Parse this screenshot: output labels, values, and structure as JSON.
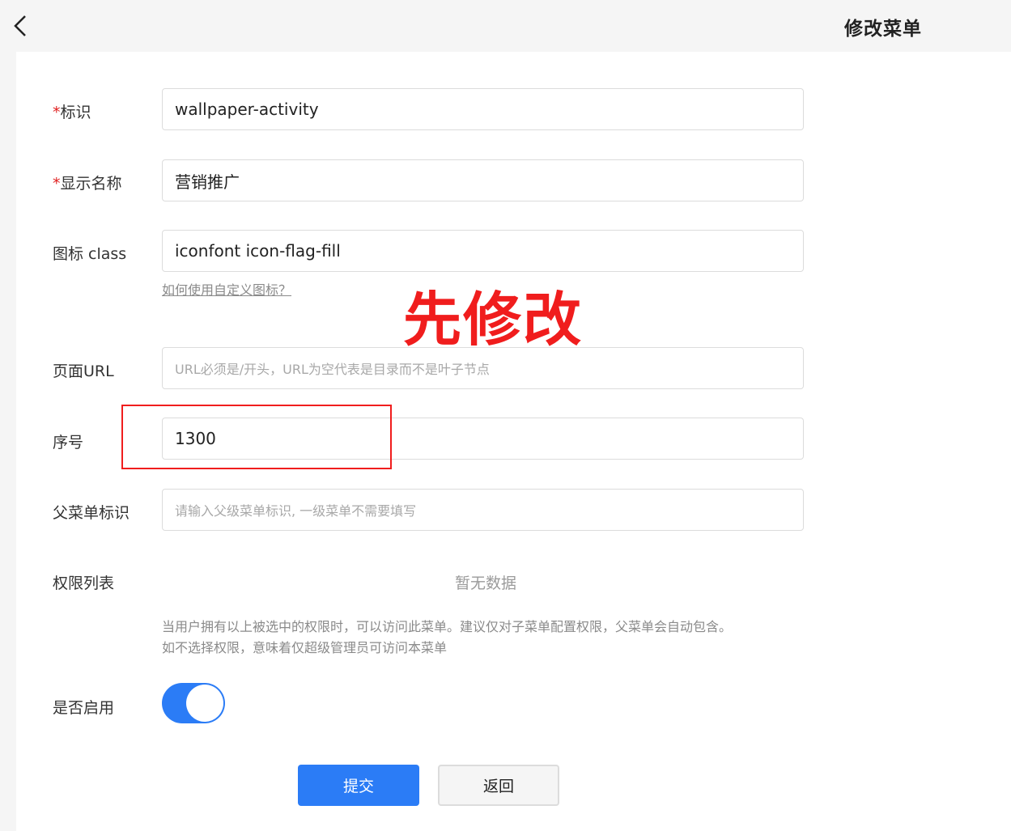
{
  "header": {
    "title": "修改菜单",
    "back_icon": "chevron-left-icon"
  },
  "form": {
    "id_field": {
      "required_mark": "*",
      "label": "标识",
      "value": "wallpaper-activity"
    },
    "name_field": {
      "required_mark": "*",
      "label": "显示名称",
      "value": "营销推广"
    },
    "icon_field": {
      "label": "图标 class",
      "value": "iconfont icon-flag-fill",
      "help_link": "如何使用自定义图标？"
    },
    "url_field": {
      "label": "页面URL",
      "value": "",
      "placeholder": "URL必须是/开头，URL为空代表是目录而不是叶子节点"
    },
    "order_field": {
      "label": "序号",
      "value": "1300"
    },
    "parent_field": {
      "label": "父菜单标识",
      "value": "",
      "placeholder": "请输入父级菜单标识, 一级菜单不需要填写"
    },
    "permission_list": {
      "label": "权限列表",
      "empty_text": "暂无数据",
      "hint_line1": "当用户拥有以上被选中的权限时，可以访问此菜单。建议仅对子菜单配置权限，父菜单会自动包含。",
      "hint_line2": "如不选择权限，意味着仅超级管理员可访问本菜单"
    },
    "enabled_field": {
      "label": "是否启用",
      "enabled": true
    }
  },
  "buttons": {
    "submit": "提交",
    "back": "返回"
  },
  "annotation": {
    "text": "先修改",
    "color": "#f01d1d"
  },
  "colors": {
    "accent": "#2b7cf6",
    "required": "#e02020"
  }
}
